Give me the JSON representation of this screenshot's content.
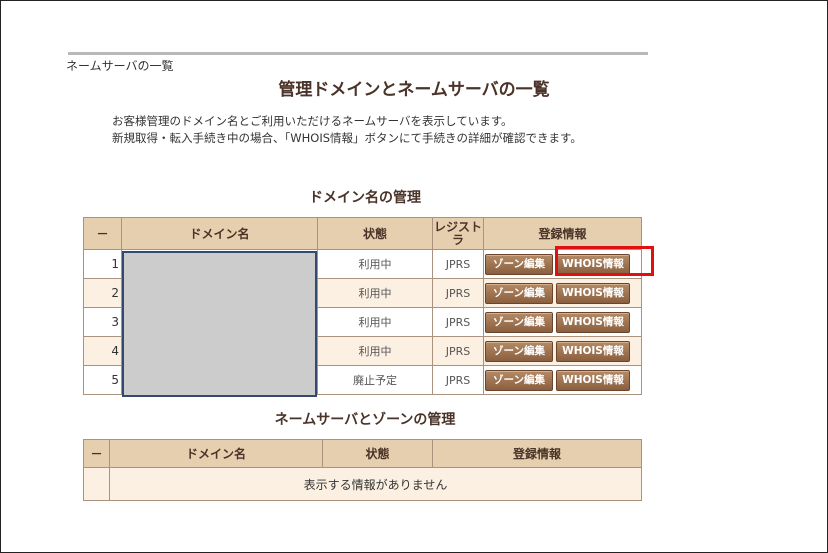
{
  "breadcrumb": "ネームサーバの一覧",
  "title": "管理ドメインとネームサーバの一覧",
  "description": [
    "お客様管理のドメイン名とご利用いただけるネームサーバを表示しています。",
    "新規取得・転入手続き中の場合、「WHOIS情報」ボタンにて手続きの詳細が確認できます。"
  ],
  "domain_section": {
    "title": "ドメイン名の管理",
    "headers": {
      "no": "－",
      "domain": "ドメイン名",
      "status": "状態",
      "registrar": "レジストラ",
      "info": "登録情報"
    },
    "rows": [
      {
        "no": "1",
        "status": "利用中",
        "registrar": "JPRS",
        "zone_label": "ゾーン編集",
        "whois_label": "WHOIS情報"
      },
      {
        "no": "2",
        "status": "利用中",
        "registrar": "JPRS",
        "zone_label": "ゾーン編集",
        "whois_label": "WHOIS情報"
      },
      {
        "no": "3",
        "status": "利用中",
        "registrar": "JPRS",
        "zone_label": "ゾーン編集",
        "whois_label": "WHOIS情報"
      },
      {
        "no": "4",
        "status": "利用中",
        "registrar": "JPRS",
        "zone_label": "ゾーン編集",
        "whois_label": "WHOIS情報"
      },
      {
        "no": "5",
        "status": "廃止予定",
        "registrar": "JPRS",
        "zone_label": "ゾーン編集",
        "whois_label": "WHOIS情報"
      }
    ]
  },
  "ns_section": {
    "title": "ネームサーバとゾーンの管理",
    "headers": {
      "no": "－",
      "domain": "ドメイン名",
      "status": "状態",
      "info": "登録情報"
    },
    "empty_message": "表示する情報がありません"
  },
  "colors": {
    "header_bg": "#e6cfae",
    "row_alt_bg": "#fcf0e2",
    "button_bg": "#9b6f4e",
    "highlight": "#e01010"
  }
}
